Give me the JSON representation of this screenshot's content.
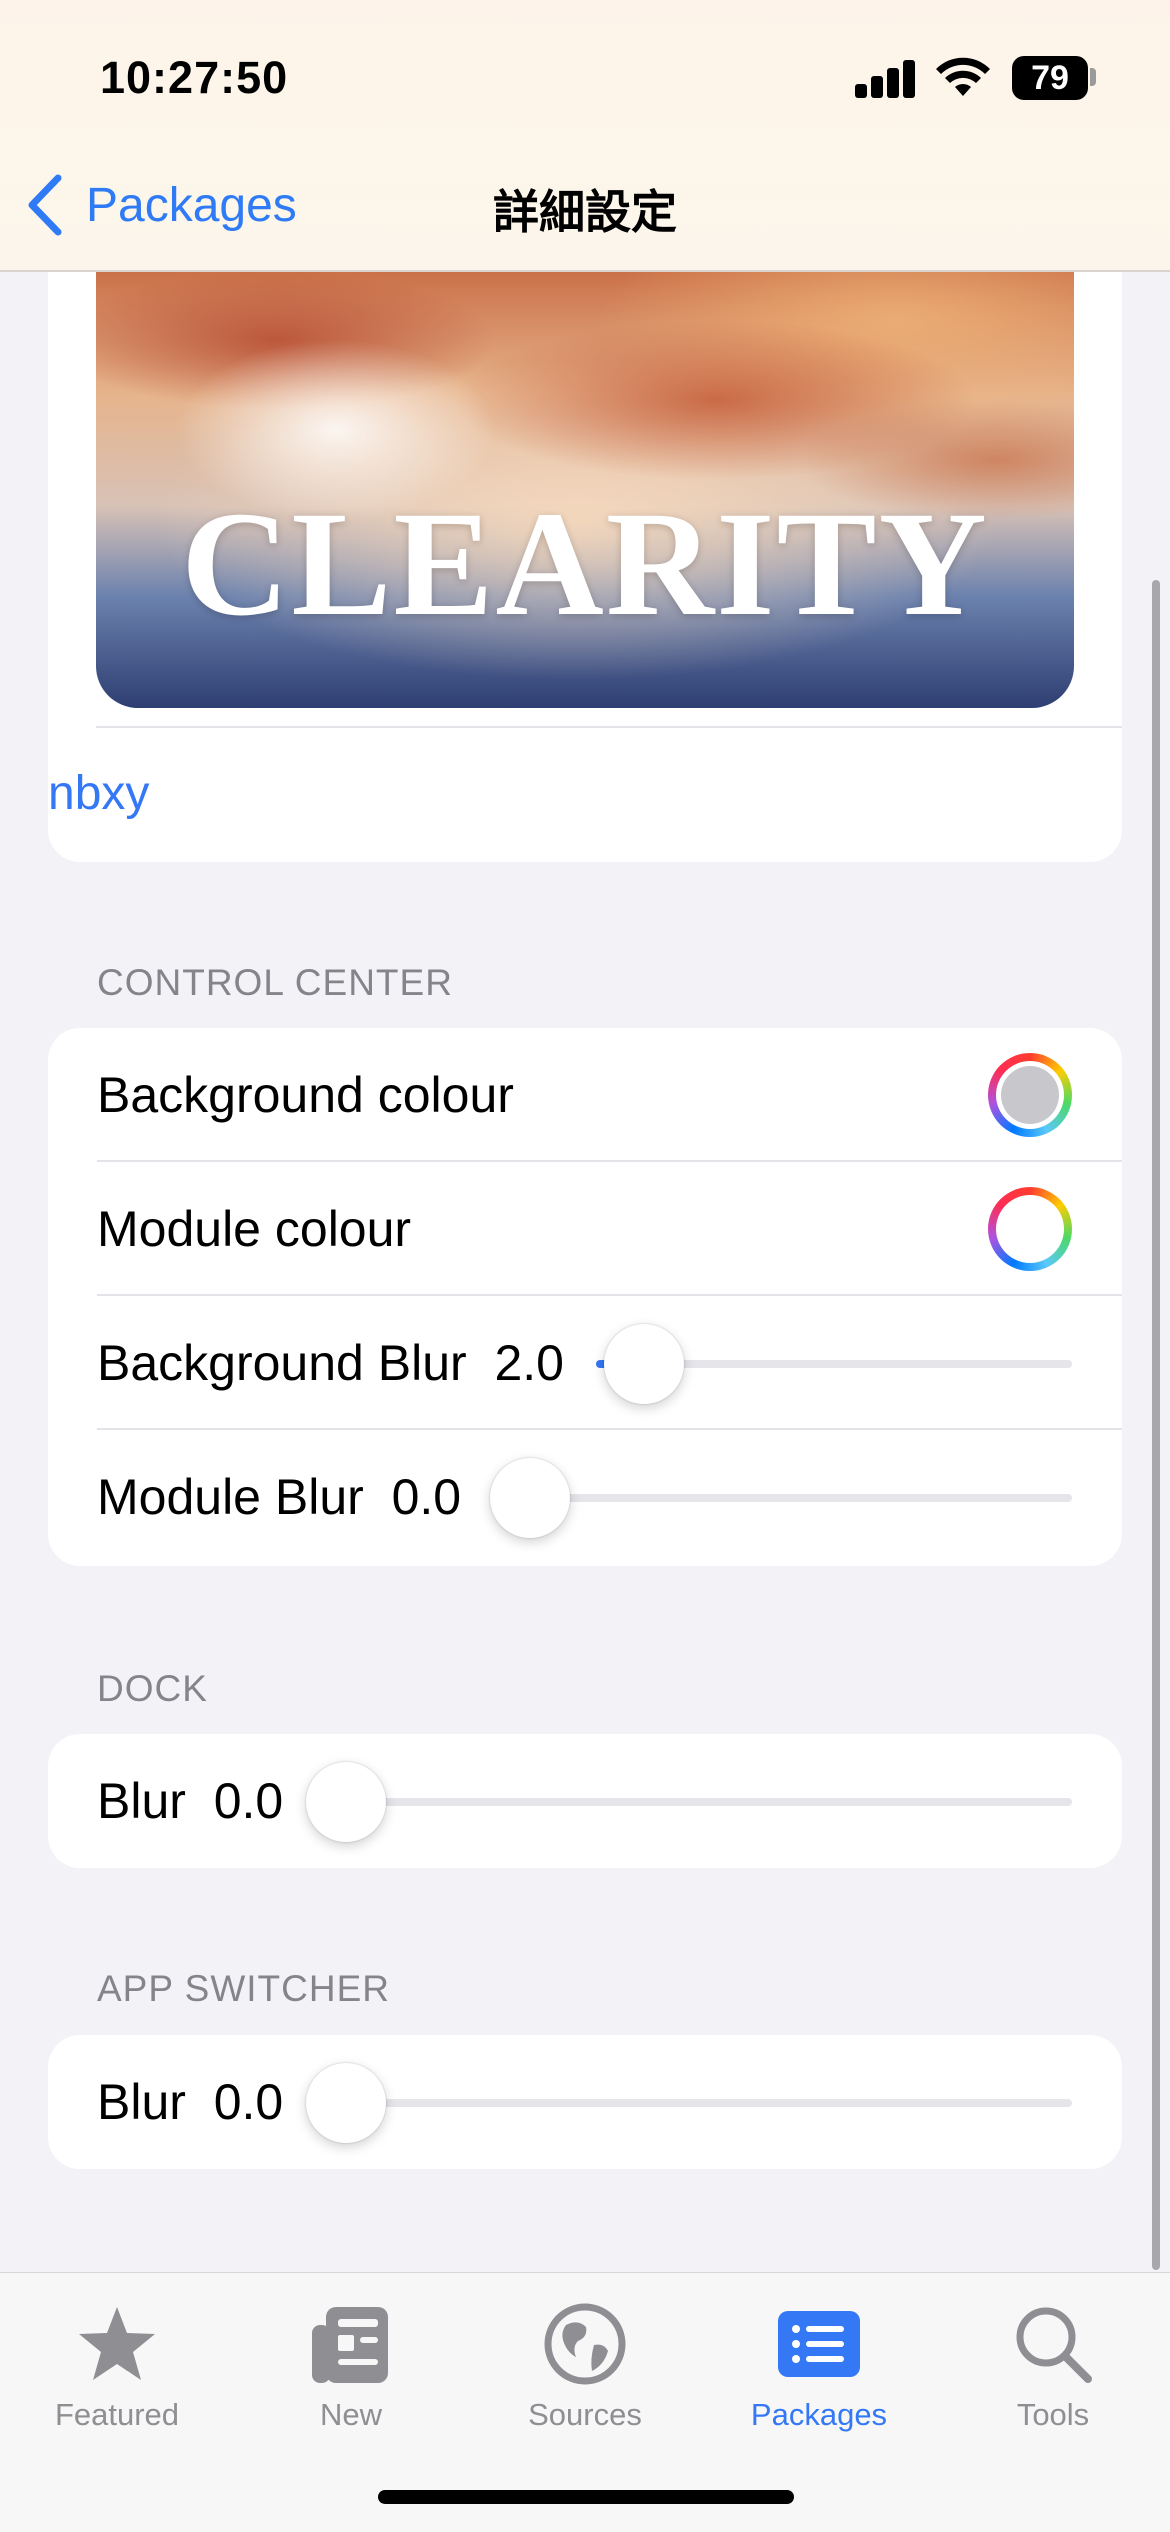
{
  "status_bar": {
    "time": "10:27:50",
    "battery": "79"
  },
  "nav": {
    "back_label": "Packages",
    "title": "詳細設定"
  },
  "banner": {
    "text": "CLEARITY",
    "author": "nbxy"
  },
  "control_center": {
    "header": "CONTROL CENTER",
    "background_colour": {
      "label": "Background colour",
      "color": "#c7c7cc"
    },
    "module_colour": {
      "label": "Module colour",
      "color": "#ffffff"
    },
    "background_blur": {
      "label": "Background Blur",
      "value": "2.0"
    },
    "module_blur": {
      "label": "Module Blur",
      "value": "0.0"
    }
  },
  "dock": {
    "header": "DOCK",
    "blur": {
      "label": "Blur",
      "value": "0.0"
    }
  },
  "app_switcher": {
    "header": "APP SWITCHER",
    "blur": {
      "label": "Blur",
      "value": "0.0"
    }
  },
  "tab_bar": {
    "active": "Packages",
    "tabs": [
      {
        "label": "Featured",
        "icon": "star-icon"
      },
      {
        "label": "New",
        "icon": "newspaper-icon"
      },
      {
        "label": "Sources",
        "icon": "globe-icon"
      },
      {
        "label": "Packages",
        "icon": "list-icon"
      },
      {
        "label": "Tools",
        "icon": "magnifier-icon"
      }
    ]
  }
}
